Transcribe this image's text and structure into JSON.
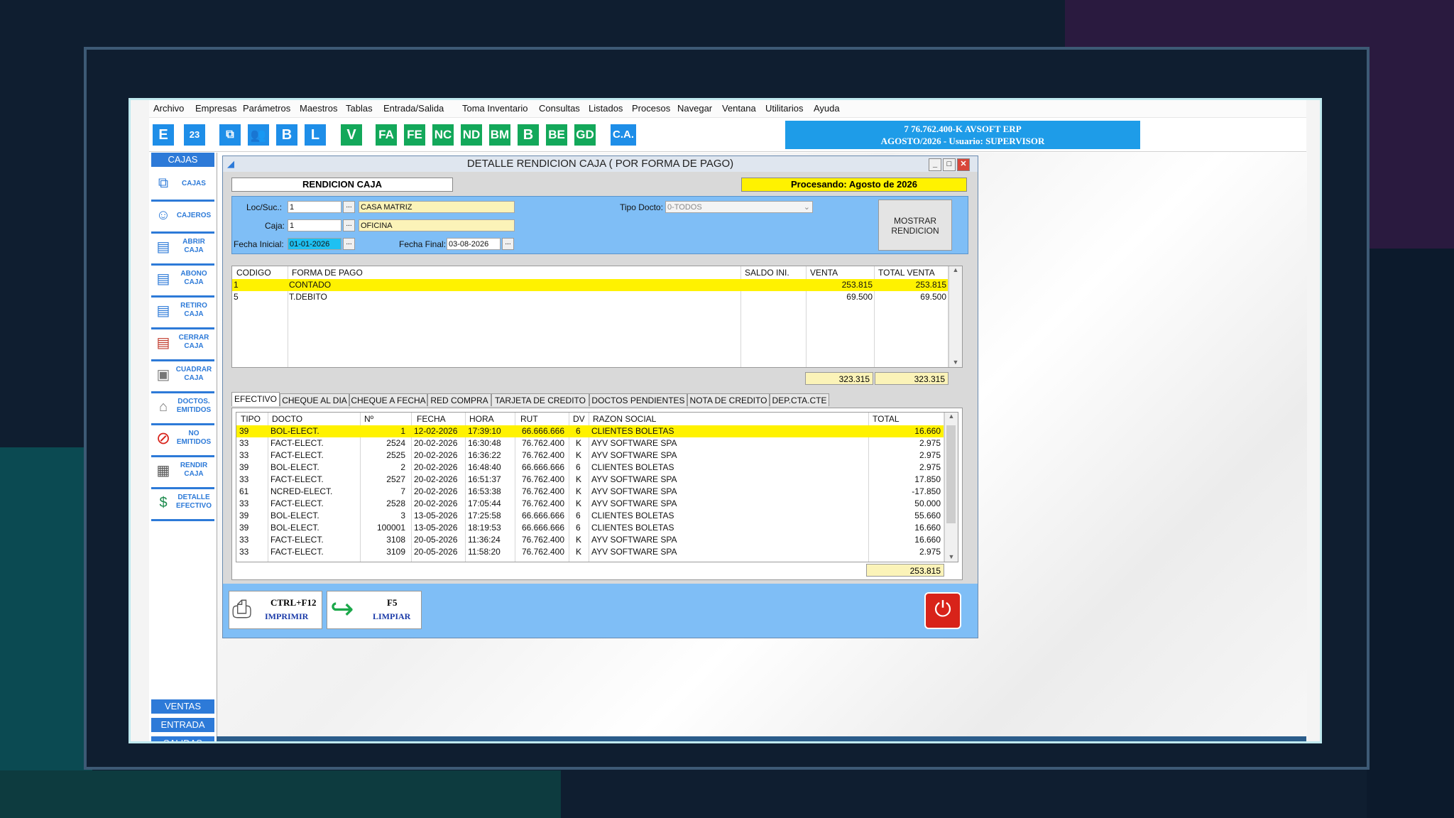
{
  "menu": [
    "Archivo",
    "Empresas",
    "Parámetros",
    "Maestros",
    "Tablas",
    "Entrada/Salida",
    "Toma Inventario",
    "Consultas",
    "Listados",
    "Procesos",
    "Navegar",
    "Ventana",
    "Utilitarios",
    "Ayuda"
  ],
  "toolbar": {
    "icons": [
      "E",
      "23",
      "B",
      "L",
      "V",
      "FA",
      "FE",
      "NC",
      "ND",
      "BM",
      "B",
      "BE",
      "GD",
      "C.A."
    ],
    "erp_line1": "7  76.762.400-K  AVSOFT ERP",
    "erp_line2": "AGOSTO/2026  -  Usuario: SUPERVISOR"
  },
  "sidebar": {
    "header": "CAJAS",
    "items": [
      {
        "label": "CAJAS",
        "icon": "network-icon"
      },
      {
        "label": "CAJEROS",
        "icon": "users-icon"
      },
      {
        "label": "ABRIR CAJA",
        "icon": "document-icon"
      },
      {
        "label": "ABONO CAJA",
        "icon": "document-icon"
      },
      {
        "label": "RETIRO CAJA",
        "icon": "document-icon"
      },
      {
        "label": "CERRAR CAJA",
        "icon": "document-icon"
      },
      {
        "label": "CUADRAR CAJA",
        "icon": "cash-register-icon"
      },
      {
        "label": "DOCTOS. EMITIDOS",
        "icon": "tag-icon"
      },
      {
        "label": "NO EMITIDOS",
        "icon": "prohibited-icon"
      },
      {
        "label": "RENDIR CAJA",
        "icon": "calculator-icon"
      },
      {
        "label": "DETALLE EFECTIVO",
        "icon": "money-icon"
      }
    ],
    "bottom": [
      "VENTAS",
      "ENTRADA",
      "SALIDAS"
    ]
  },
  "window": {
    "title": "DETALLE RENDICION CAJA ( POR FORMA DE PAGO)",
    "section_label": "RENDICION CAJA",
    "processing": "Procesando: Agosto de 2026",
    "form": {
      "loc_label": "Loc/Suc.:",
      "loc_code": "1",
      "loc_name": "CASA MATRIZ",
      "caja_label": "Caja:",
      "caja_code": "1",
      "caja_name": "OFICINA",
      "fecha_ini_label": "Fecha Inicial:",
      "fecha_ini": "01-01-2026",
      "fecha_fin_label": "Fecha Final:",
      "fecha_fin": "03-08-2026",
      "tipo_label": "Tipo Docto:",
      "tipo_value": "0-TODOS",
      "mostrar_button": "MOSTRAR RENDICION"
    },
    "payments": {
      "headers": [
        "CODIGO",
        "FORMA DE PAGO",
        "SALDO INI.",
        "VENTA",
        "TOTAL VENTA"
      ],
      "rows": [
        [
          "1",
          "CONTADO",
          "",
          "253.815",
          "253.815"
        ],
        [
          "5",
          "T.DEBITO",
          "",
          "69.500",
          "69.500"
        ]
      ],
      "total_venta": "323.315",
      "total_total": "323.315"
    },
    "tabs": [
      "EFECTIVO",
      "CHEQUE AL DIA",
      "CHEQUE A FECHA",
      "RED COMPRA",
      "TARJETA DE CREDITO",
      "DOCTOS PENDIENTES",
      "NOTA DE CREDITO",
      "DEP.CTA.CTE"
    ],
    "docs": {
      "headers": [
        "TIPO",
        "DOCTO",
        "Nº",
        "FECHA",
        "HORA",
        "RUT",
        "DV",
        "RAZON SOCIAL",
        "TOTAL"
      ],
      "rows": [
        [
          "39",
          "BOL-ELECT.",
          "1",
          "12-02-2026",
          "17:39:10",
          "66.666.666",
          "6",
          "CLIENTES BOLETAS",
          "16.660"
        ],
        [
          "33",
          "FACT-ELECT.",
          "2524",
          "20-02-2026",
          "16:30:48",
          "76.762.400",
          "K",
          "AYV SOFTWARE SPA",
          "2.975"
        ],
        [
          "33",
          "FACT-ELECT.",
          "2525",
          "20-02-2026",
          "16:36:22",
          "76.762.400",
          "K",
          "AYV SOFTWARE SPA",
          "2.975"
        ],
        [
          "39",
          "BOL-ELECT.",
          "2",
          "20-02-2026",
          "16:48:40",
          "66.666.666",
          "6",
          "CLIENTES BOLETAS",
          "2.975"
        ],
        [
          "33",
          "FACT-ELECT.",
          "2527",
          "20-02-2026",
          "16:51:37",
          "76.762.400",
          "K",
          "AYV SOFTWARE SPA",
          "17.850"
        ],
        [
          "61",
          "NCRED-ELECT.",
          "7",
          "20-02-2026",
          "16:53:38",
          "76.762.400",
          "K",
          "AYV SOFTWARE SPA",
          "-17.850"
        ],
        [
          "33",
          "FACT-ELECT.",
          "2528",
          "20-02-2026",
          "17:05:44",
          "76.762.400",
          "K",
          "AYV SOFTWARE SPA",
          "50.000"
        ],
        [
          "39",
          "BOL-ELECT.",
          "3",
          "13-05-2026",
          "17:25:58",
          "66.666.666",
          "6",
          "CLIENTES BOLETAS",
          "55.660"
        ],
        [
          "39",
          "BOL-ELECT.",
          "100001",
          "13-05-2026",
          "18:19:53",
          "66.666.666",
          "6",
          "CLIENTES BOLETAS",
          "16.660"
        ],
        [
          "33",
          "FACT-ELECT.",
          "3108",
          "20-05-2026",
          "11:36:24",
          "76.762.400",
          "K",
          "AYV SOFTWARE SPA",
          "16.660"
        ],
        [
          "33",
          "FACT-ELECT.",
          "3109",
          "20-05-2026",
          "11:58:20",
          "76.762.400",
          "K",
          "AYV SOFTWARE SPA",
          "2.975"
        ]
      ],
      "total": "253.815"
    },
    "buttons": {
      "print_key": "CTRL+F12",
      "print_label": "IMPRIMIR",
      "clear_key": "F5",
      "clear_label": "LIMPIAR"
    }
  },
  "colors": {
    "accent": "#2d7ad8",
    "highlight": "#fff200",
    "panel": "#7fbef6",
    "close": "#d8463a"
  }
}
